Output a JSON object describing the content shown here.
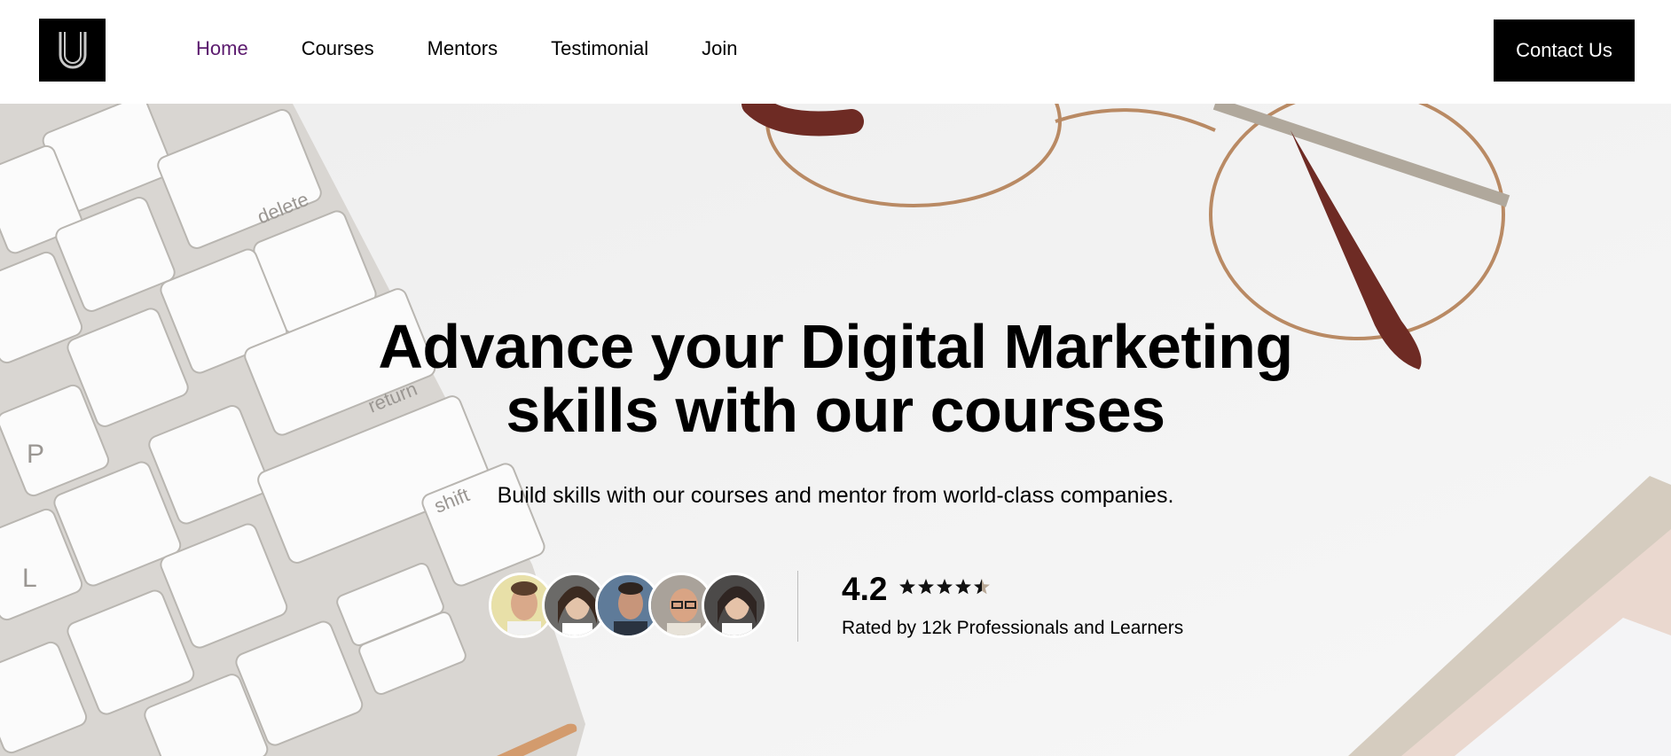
{
  "header": {
    "logo_letter": "U",
    "nav": [
      "Home",
      "Courses",
      "Mentors",
      "Testimonial",
      "Join"
    ],
    "active_nav": "Home",
    "contact_label": "Contact Us"
  },
  "hero": {
    "title_line1": "Advance your Digital Marketing",
    "title_line2": "skills with our courses",
    "subtitle": "Build skills with our courses and mentor from world-class companies.",
    "rating_value": "4.2",
    "rating_stars": 4.2,
    "rating_caption": "Rated by 12k Professionals and Learners",
    "avatars": [
      "avatar-1",
      "avatar-2",
      "avatar-3",
      "avatar-4",
      "avatar-5"
    ]
  },
  "colors": {
    "active_nav": "#5b1a6e",
    "button_bg": "#000000",
    "button_text": "#ffffff"
  }
}
